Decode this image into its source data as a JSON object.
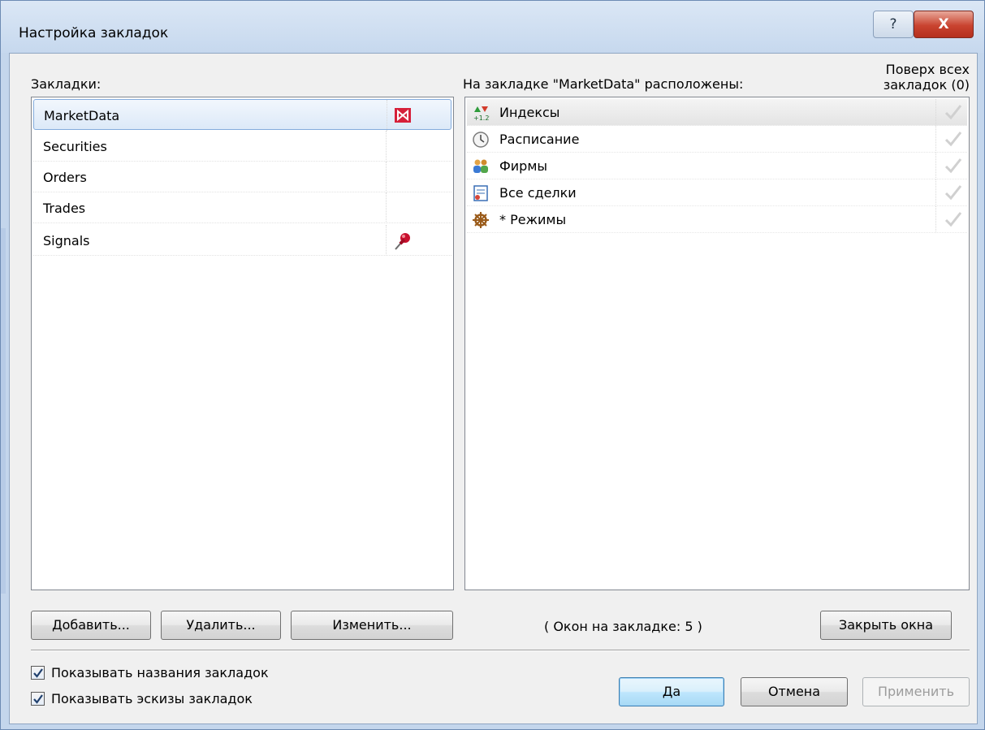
{
  "window": {
    "title": "Настройка закладок",
    "help_label": "?",
    "close_label": "X"
  },
  "labels": {
    "bookmarks": "Закладки:",
    "contents": "На закладке \"MarketData\" расположены:",
    "ontop": "Поверх всех закладок (0)"
  },
  "bookmarks": [
    {
      "name": "MarketData",
      "icon": "moex-logo-icon",
      "selected": true
    },
    {
      "name": "Securities",
      "icon": "",
      "selected": false
    },
    {
      "name": "Orders",
      "icon": "",
      "selected": false
    },
    {
      "name": "Trades",
      "icon": "",
      "selected": false
    },
    {
      "name": "Signals",
      "icon": "pushpin-icon",
      "selected": false
    }
  ],
  "windows": [
    {
      "name": "Индексы",
      "icon": "index-chart-icon",
      "highlighted": true
    },
    {
      "name": "Расписание",
      "icon": "clock-icon",
      "highlighted": false
    },
    {
      "name": "Фирмы",
      "icon": "people-icon",
      "highlighted": false
    },
    {
      "name": "Все сделки",
      "icon": "trades-table-icon",
      "highlighted": false
    },
    {
      "name": "* Режимы",
      "icon": "ship-wheel-icon",
      "highlighted": false
    }
  ],
  "buttons": {
    "add": "Добавить...",
    "delete": "Удалить...",
    "edit": "Изменить...",
    "close_windows": "Закрыть окна",
    "ok": "Да",
    "cancel": "Отмена",
    "apply": "Применить"
  },
  "status": {
    "window_count": "( Окон на закладке: 5 )"
  },
  "options": {
    "show_names": {
      "label": "Показывать названия закладок",
      "checked": true
    },
    "show_thumbnails": {
      "label": "Показывать эскизы закладок",
      "checked": true
    }
  },
  "colors": {
    "selection": "#dce9f8",
    "moex_red": "#d6203a",
    "pin_red": "#c8102e"
  }
}
